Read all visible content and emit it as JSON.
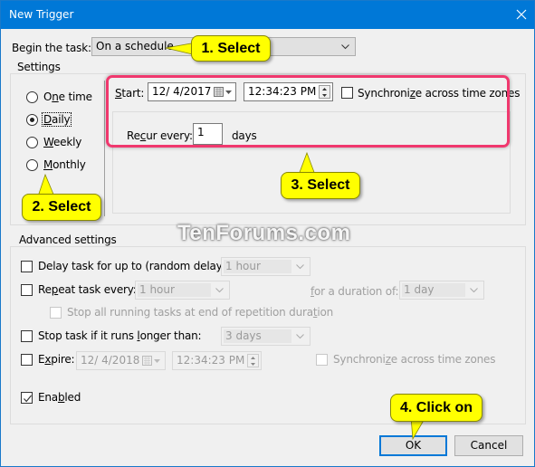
{
  "window": {
    "title": "New Trigger",
    "close_icon": "close-icon"
  },
  "begin_task": {
    "label": "Begin the task:",
    "value": "On a schedule"
  },
  "settings": {
    "title": "Settings",
    "radios": [
      {
        "label": "One time",
        "mnemonic": "n",
        "checked": false
      },
      {
        "label": "Daily",
        "mnemonic": "D",
        "checked": true
      },
      {
        "label": "Weekly",
        "mnemonic": "W",
        "checked": false
      },
      {
        "label": "Monthly",
        "mnemonic": "M",
        "checked": false
      }
    ],
    "start_label": "Start:",
    "start_date": "12/  4/2017",
    "start_time": "12:34:23 PM",
    "sync_label": "Synchronize across time zones",
    "sync_checked": false,
    "recur_label": "Recur every:",
    "recur_value": "1",
    "recur_unit": "days"
  },
  "advanced": {
    "title": "Advanced settings",
    "delay_label": "Delay task for up to (random delay):",
    "delay_value": "1 hour",
    "delay_checked": false,
    "repeat_label": "Repeat task every:",
    "repeat_value": "1 hour",
    "repeat_checked": false,
    "duration_label": "for a duration of:",
    "duration_value": "1 day",
    "stop_all_label": "Stop all running tasks at end of repetition duration",
    "stop_all_checked": false,
    "stop_if_label": "Stop task if it runs longer than:",
    "stop_if_value": "3 days",
    "stop_if_checked": false,
    "expire_label": "Expire:",
    "expire_date": "12/  4/2018",
    "expire_time": "12:34:23 PM",
    "expire_checked": false,
    "expire_sync_label": "Synchronize across time zones",
    "enabled_label": "Enabled",
    "enabled_checked": true
  },
  "buttons": {
    "ok": "OK",
    "cancel": "Cancel"
  },
  "annotations": {
    "step1": "1. Select",
    "step2": "2. Select",
    "step3": "3. Select",
    "step4": "4. Click on",
    "watermark": "TenForums.com",
    "callout_color": "#ffff00",
    "highlight_color": "#f0386e"
  },
  "colors": {
    "titlebar": "#0078d7",
    "dialog_bg": "#f0f0f0"
  }
}
